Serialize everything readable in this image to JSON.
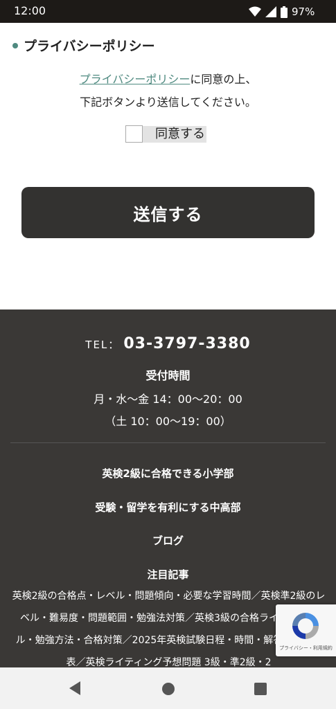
{
  "status_bar": {
    "time": "12:00",
    "battery": "97%"
  },
  "section": {
    "title": "プライバシーポリシー"
  },
  "notice": {
    "link_text": "プライバシーポリシー",
    "line1_rest": "に同意の上、",
    "line2": "下記ボタンより送信してください。"
  },
  "agree": {
    "label": "同意する"
  },
  "submit": {
    "label": "送信する"
  },
  "footer": {
    "tel_label": "TEL：",
    "tel_number": "03-3797-3380",
    "hours_title": "受付時間",
    "hours_1": "月・水〜金 14：00〜20：00",
    "hours_2": "（土 10：00〜19：00）",
    "links": [
      "英検2級に合格できる小学部",
      "受験・留学を有利にする中高部",
      "ブログ",
      "注目記事"
    ],
    "articles": "英検2級の合格点・レベル・問題傾向・必要な学習時間／英検準2級のレベル・難易度・問題範囲・勉強法対策／英検3級の合格ライン・レベル・勉強方法・合格対策／2025年英検試験日程・時間・解答・合格発表／英検ライティング予想問題 3級・準2級・2"
  },
  "recaptcha": {
    "text": "プライバシー・利用規約"
  },
  "colors": {
    "accent": "#4f8a80",
    "button": "#333230",
    "footer": "#3a3836"
  }
}
